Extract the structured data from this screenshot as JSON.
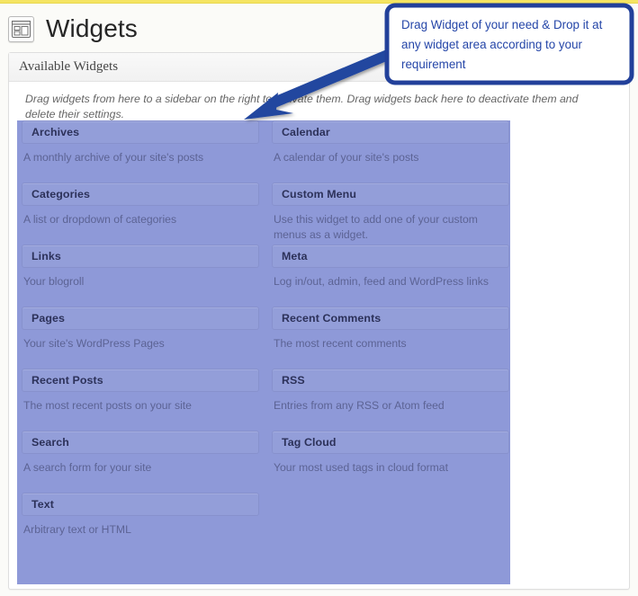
{
  "page": {
    "title": "Widgets",
    "icon": "widgets-layout-icon"
  },
  "panel": {
    "heading": "Available Widgets",
    "description": "Drag widgets from here to a sidebar on the right to activate them. Drag widgets back here to deactivate them and delete their settings."
  },
  "callout": {
    "text": "Drag Widget of your need & Drop it at any widget area according to your requirement",
    "border_color": "#22409a",
    "text_color": "#2546a8",
    "background_color": "#ffffff",
    "arrow_color": "#23479f"
  },
  "colors": {
    "drop_region": "#8e99d8",
    "widget_header": "#939ed9",
    "widget_header_border": "#8791cd",
    "widget_title_text": "#2c3159",
    "widget_desc_text": "#5c6394",
    "top_rule": "#f5e462",
    "panel_border": "#dedede"
  },
  "widgets": {
    "left_column": [
      {
        "title": "Archives",
        "description": "A monthly archive of your site's posts"
      },
      {
        "title": "Categories",
        "description": "A list or dropdown of categories"
      },
      {
        "title": "Links",
        "description": "Your blogroll"
      },
      {
        "title": "Pages",
        "description": "Your site's WordPress Pages"
      },
      {
        "title": "Recent Posts",
        "description": "The most recent posts on your site"
      },
      {
        "title": "Search",
        "description": "A search form for your site"
      },
      {
        "title": "Text",
        "description": "Arbitrary text or HTML"
      }
    ],
    "right_column": [
      {
        "title": "Calendar",
        "description": "A calendar of your site's posts"
      },
      {
        "title": "Custom Menu",
        "description": "Use this widget to add one of your custom menus as a widget."
      },
      {
        "title": "Meta",
        "description": "Log in/out, admin, feed and WordPress links"
      },
      {
        "title": "Recent Comments",
        "description": "The most recent comments"
      },
      {
        "title": "RSS",
        "description": "Entries from any RSS or Atom feed"
      },
      {
        "title": "Tag Cloud",
        "description": "Your most used tags in cloud format"
      }
    ]
  },
  "layout": {
    "left_column_tops": [
      0,
      69,
      138,
      207,
      276,
      345,
      414
    ],
    "right_column_tops": [
      0,
      69,
      138,
      207,
      276,
      345
    ]
  }
}
